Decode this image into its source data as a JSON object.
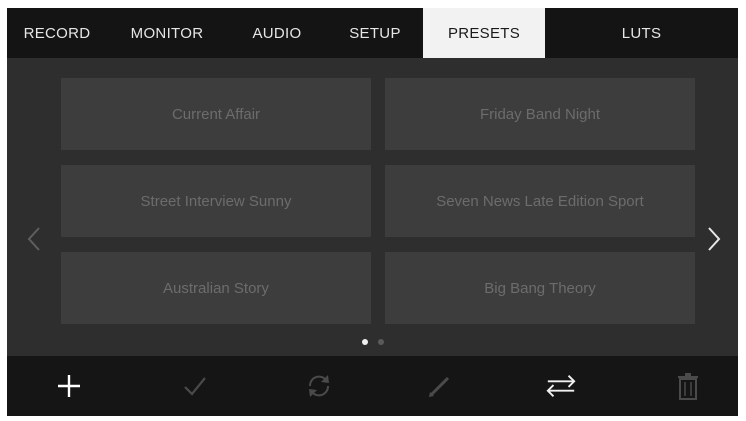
{
  "tabs": [
    {
      "label": "RECORD",
      "active": false
    },
    {
      "label": "MONITOR",
      "active": false
    },
    {
      "label": "AUDIO",
      "active": false
    },
    {
      "label": "SETUP",
      "active": false
    },
    {
      "label": "PRESETS",
      "active": true
    },
    {
      "label": "LUTS",
      "active": false
    }
  ],
  "presets": [
    "Current Affair",
    "Friday Band Night",
    "Street Interview Sunny",
    "Seven News Late Edition Sport",
    "Australian Story",
    "Big Bang Theory"
  ],
  "pagination": {
    "current": 1,
    "total": 2
  },
  "nav": {
    "prev_icon": "chevron-left-icon",
    "next_icon": "chevron-right-icon"
  },
  "toolbar": {
    "icons": [
      "plus-icon",
      "checkmark-icon",
      "refresh-icon",
      "pencil-icon",
      "import-export-icon",
      "trash-icon"
    ],
    "enabled": [
      true,
      false,
      false,
      false,
      true,
      false
    ]
  },
  "colors": {
    "tab_bar": "#141414",
    "active_tab": "#f2f2f2",
    "preset_button": "#3d3d3d",
    "preset_text": "#6c6c6c",
    "toolbar": "#151515"
  }
}
